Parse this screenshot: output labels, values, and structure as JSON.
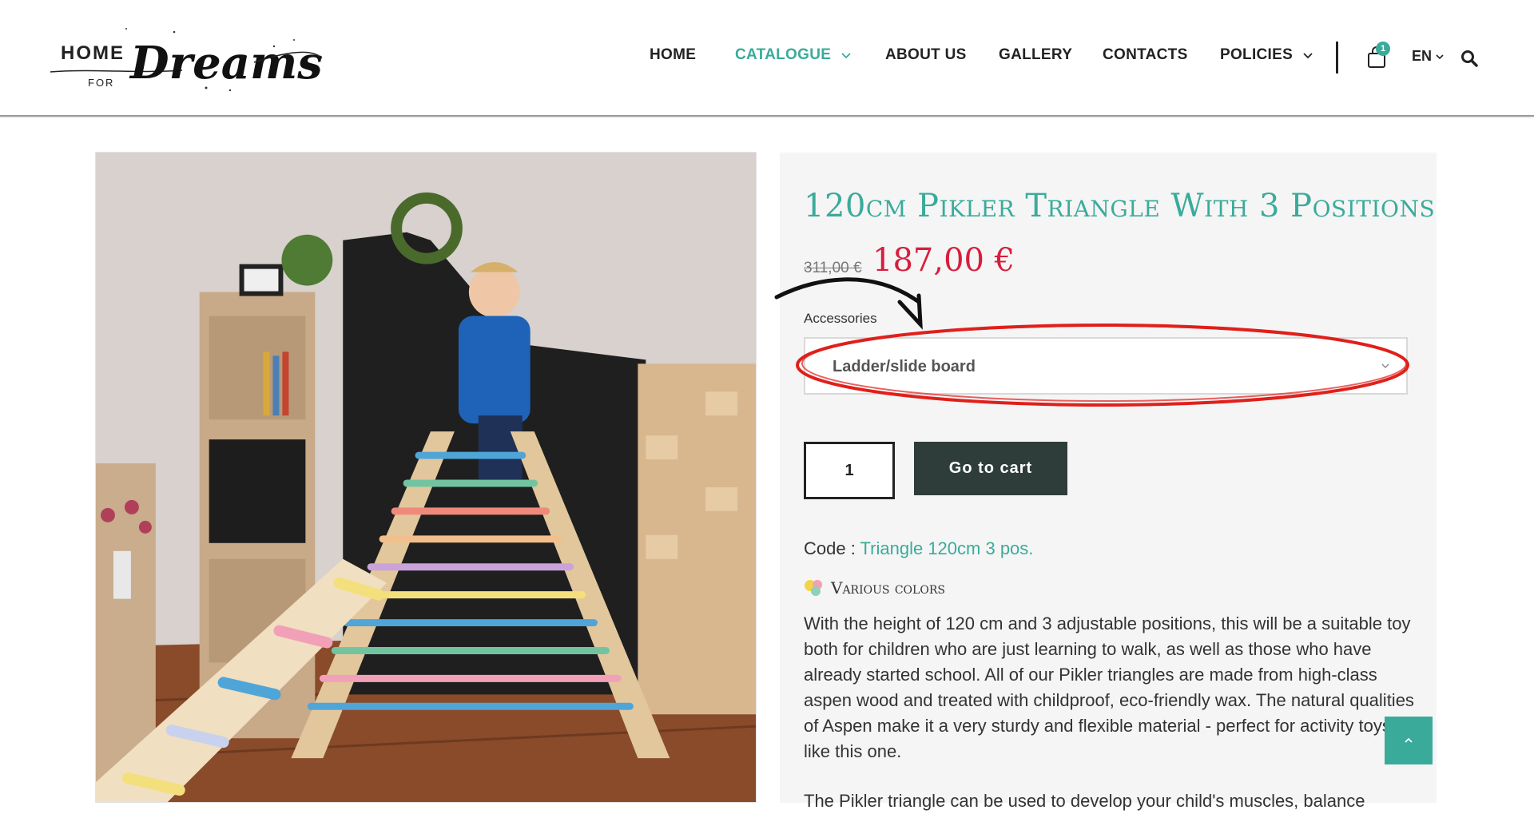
{
  "brand": {
    "logo_top": "HOME",
    "logo_for": "FOR",
    "logo_script": "Dreams"
  },
  "nav": {
    "items": [
      {
        "label": "HOME"
      },
      {
        "label": "CATALOGUE"
      },
      {
        "label": "ABOUT US"
      },
      {
        "label": "GALLERY"
      },
      {
        "label": "CONTACTS"
      },
      {
        "label": "POLICIES"
      }
    ],
    "cart_count": "1",
    "language": "EN"
  },
  "product": {
    "title": "120cm Pikler Triangle With 3 Positions",
    "old_price": "311,00 €",
    "price": "187,00 €",
    "accessories_label": "Accessories",
    "accessories_value": "Ladder/slide board",
    "quantity": "1",
    "go_to_cart": "Go to cart",
    "code_label": "Code : ",
    "code_value": "Triangle 120cm 3 pos.",
    "colors_label": "Various colors",
    "description": "With the height of 120 cm and 3 adjustable positions, this will be a suitable toy both for children who are just learning to walk, as well as those who have already started school. All of our Pikler triangles are made from high-class aspen wood and treated with childproof, eco-friendly wax. The natural qualities of Aspen make it a very sturdy and flexible material - perfect for activity toys like this one.",
    "description_next": "The Pikler triangle can be used to develop your child's muscles, balance"
  },
  "colors": {
    "accent": "#3aab9b",
    "price": "#d71e3c",
    "button": "#2e3d3a",
    "annotation": "#e0201b"
  }
}
